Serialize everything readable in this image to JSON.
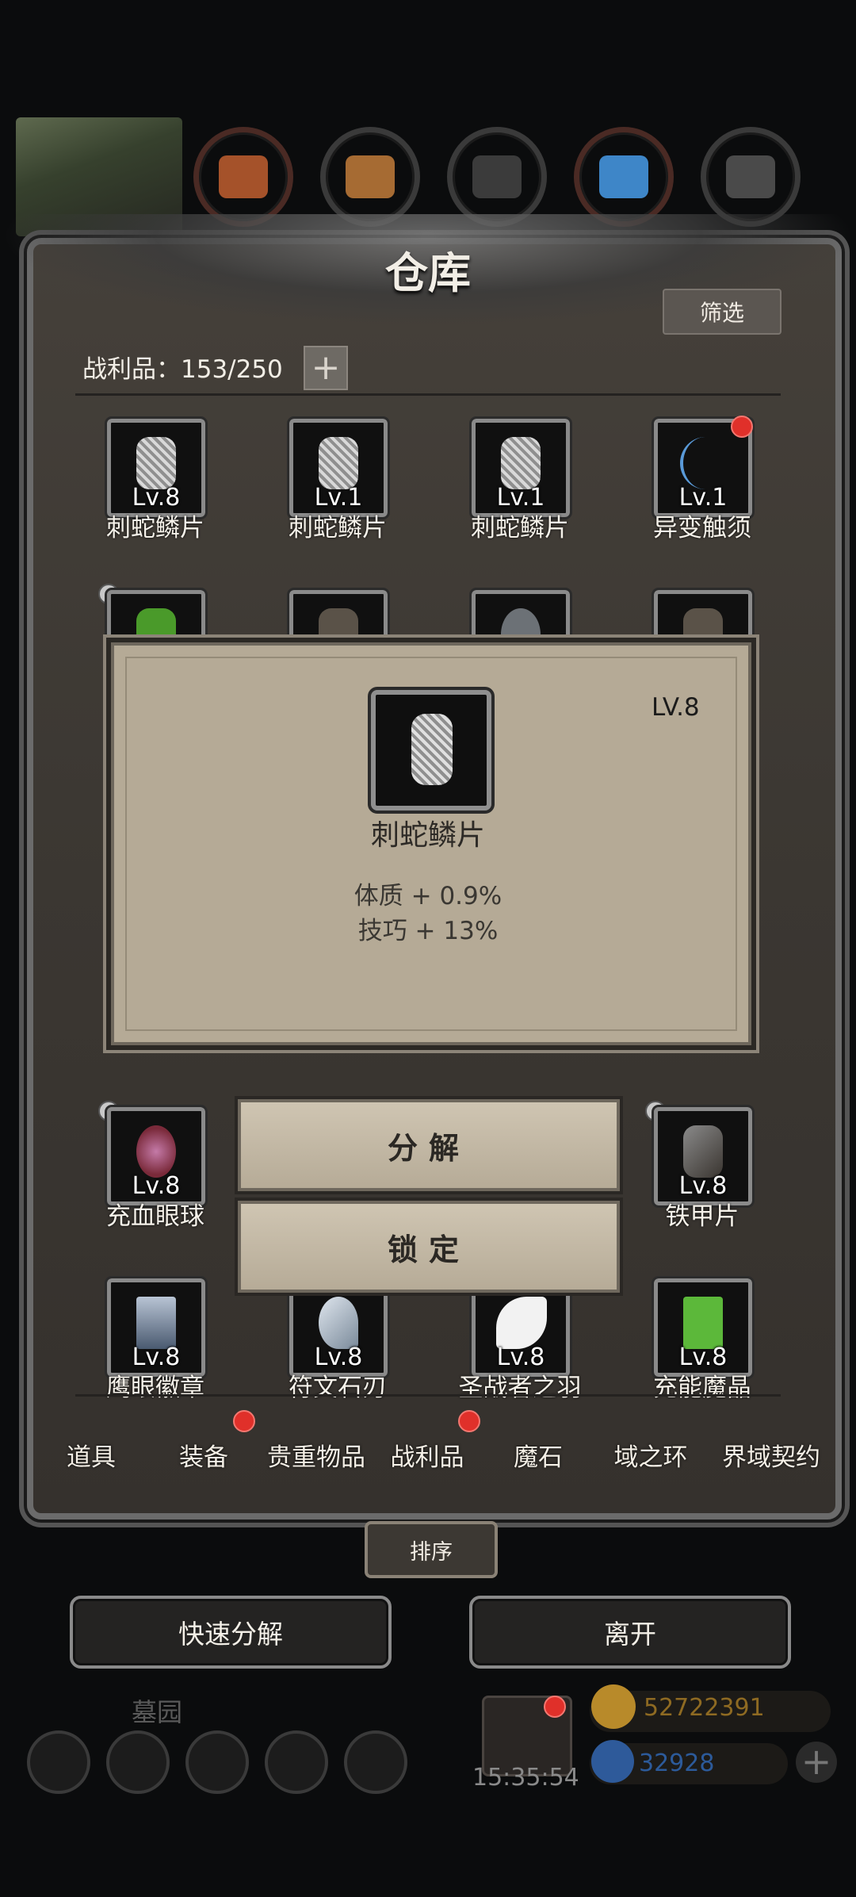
{
  "header": {
    "title": "仓库",
    "filter_label": "筛选",
    "loot_label": "战利品：",
    "loot_count": "153/250"
  },
  "items": [
    {
      "lv": "Lv.8",
      "name": "刺蛇鳞片"
    },
    {
      "lv": "Lv.1",
      "name": "刺蛇鳞片"
    },
    {
      "lv": "Lv.1",
      "name": "刺蛇鳞片"
    },
    {
      "lv": "Lv.1",
      "name": "异变触须"
    },
    {
      "lv": "Lv.8",
      "name": "充血眼球"
    },
    {
      "lv": "Lv.8",
      "name": "铁甲片"
    },
    {
      "lv": "Lv.8",
      "name": "鹰眼徽章"
    },
    {
      "lv": "Lv.8",
      "name": "符文石刃"
    },
    {
      "lv": "Lv.8",
      "name": "圣战者之羽"
    },
    {
      "lv": "Lv.8",
      "name": "充能魔晶"
    }
  ],
  "popup": {
    "level": "LV.8",
    "name": "刺蛇鳞片",
    "stat1": "体质 + 0.9%",
    "stat2": "技巧 + 13%"
  },
  "actions": {
    "decompose": "分解",
    "lock": "锁定"
  },
  "tabs": [
    "道具",
    "装备",
    "贵重物品",
    "战利品",
    "魔石",
    "域之环",
    "界域契约"
  ],
  "bottom": {
    "sort_label": "排序",
    "quick_decompose": "快速分解",
    "leave": "离开",
    "location": "墓园",
    "timer": "15:35:54",
    "gold": "52722391",
    "gems": "32928"
  },
  "colors": {
    "accent_red": "#e0302a",
    "gold_text": "#c8962a",
    "gem_text": "#3a7ad8"
  }
}
